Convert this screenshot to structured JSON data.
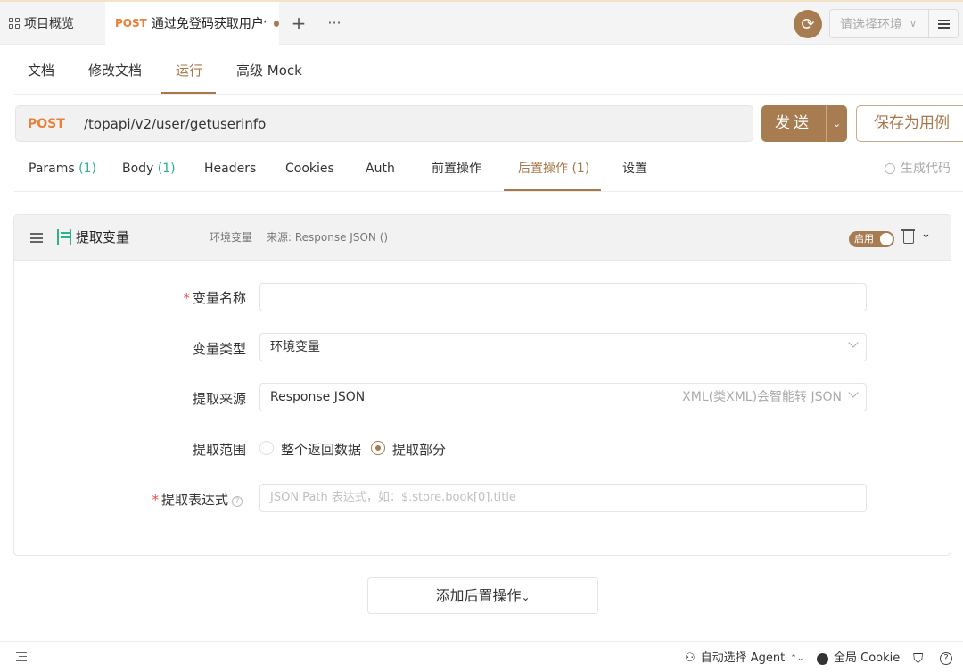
{
  "tabbar": {
    "overview_label": "项目概览",
    "active_tab": {
      "method": "POST",
      "title": "通过免登码获取用户信息"
    },
    "plus": "+",
    "more": "···",
    "env_placeholder": "请选择环境",
    "env_caret": "∨"
  },
  "subtabs": [
    "文档",
    "修改文档",
    "运行",
    "高级 Mock"
  ],
  "request": {
    "method": "POST",
    "path": "/topapi/v2/user/getuserinfo",
    "send_label": "发送",
    "send_caret": "⌄",
    "save_case_label": "保存为用例"
  },
  "paramtabs": [
    {
      "label": "Params",
      "count": "(1)"
    },
    {
      "label": "Body",
      "count": "(1)"
    },
    {
      "label": "Headers",
      "count": ""
    },
    {
      "label": "Cookies",
      "count": ""
    },
    {
      "label": "Auth",
      "count": ""
    },
    {
      "label": "前置操作",
      "count": ""
    },
    {
      "label": "后置操作",
      "count": "(1)"
    },
    {
      "label": "设置",
      "count": ""
    }
  ],
  "gen_code_label": "生成代码",
  "card": {
    "title": "提取变量",
    "meta_type": "环境变量",
    "meta_source": "来源: Response JSON ()",
    "toggle_label": "启用",
    "chevron": "⌄"
  },
  "form": {
    "var_name_label": "变量名称",
    "var_name_value": "",
    "var_type_label": "变量类型",
    "var_type_value": "环境变量",
    "source_label": "提取来源",
    "source_value": "Response JSON",
    "source_hint": "XML(类XML)会智能转 JSON",
    "scope_label": "提取范围",
    "scope_options": [
      "整个返回数据",
      "提取部分"
    ],
    "scope_selected": "提取部分",
    "expr_label": "提取表达式",
    "expr_placeholder": "JSON Path 表达式，如：$.store.book[0].title",
    "help_glyph": "?"
  },
  "add_after_label": "添加后置操作",
  "add_after_caret": "⌄",
  "statusbar": {
    "agent_label": "自动选择 Agent",
    "agent_caret": "⌃⌄",
    "cookie_label": "全局 Cookie",
    "shirt_glyph": "⛉",
    "help_glyph": "?"
  },
  "colors": {
    "accent": "#a67c50",
    "method_post": "#e8803a",
    "count_green": "#2bb48c",
    "required": "#e84848"
  }
}
